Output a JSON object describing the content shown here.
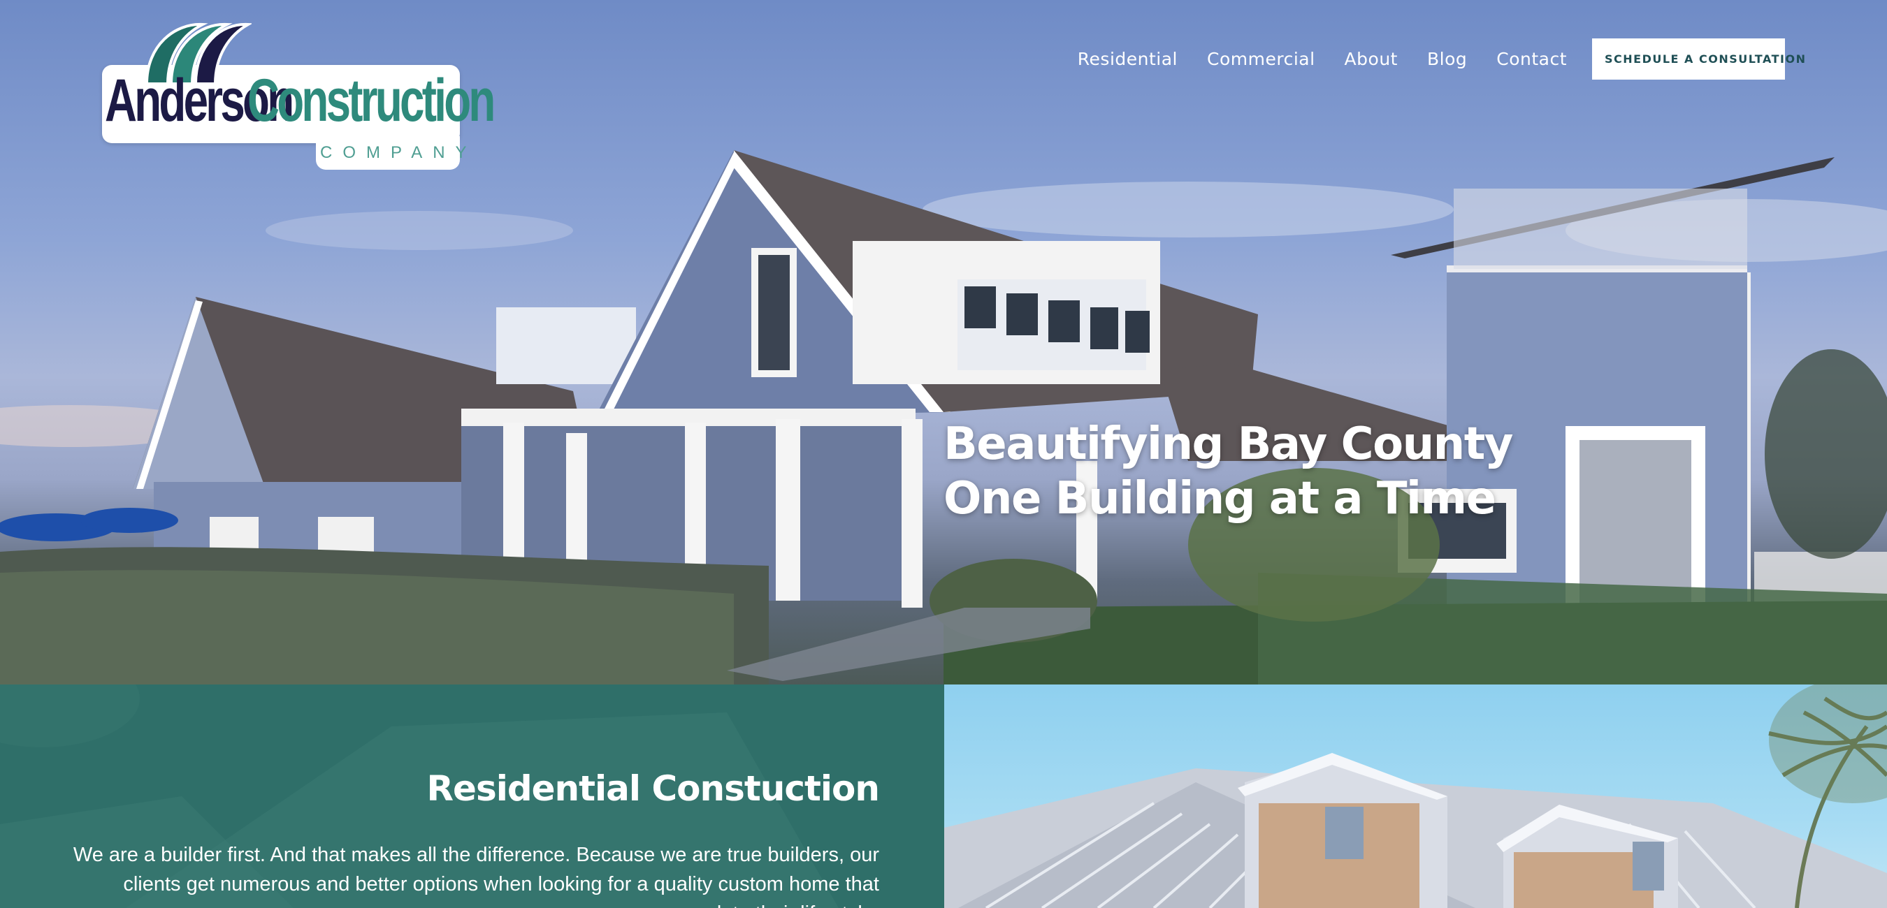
{
  "brand": {
    "logo_word_1": "Anderson",
    "logo_word_2": "Construction",
    "logo_sub": "COMPANY",
    "colors": {
      "navy": "#1c1a45",
      "teal": "#2e8a7c",
      "section_teal": "#2f6f69"
    }
  },
  "nav": {
    "items": [
      {
        "label": "Residential"
      },
      {
        "label": "Commercial"
      },
      {
        "label": "About"
      },
      {
        "label": "Blog"
      },
      {
        "label": "Contact"
      }
    ],
    "cta_label": "SCHEDULE A CONSULTATION"
  },
  "hero": {
    "headline_line_1": "Beautifying Bay County",
    "headline_line_2": "One Building at a Time"
  },
  "residential": {
    "title": "Residential Constuction",
    "body": "We are a builder first. And that makes all the difference. Because we are true builders, our clients get numerous and better options when looking for a quality custom home that complete their life style."
  }
}
